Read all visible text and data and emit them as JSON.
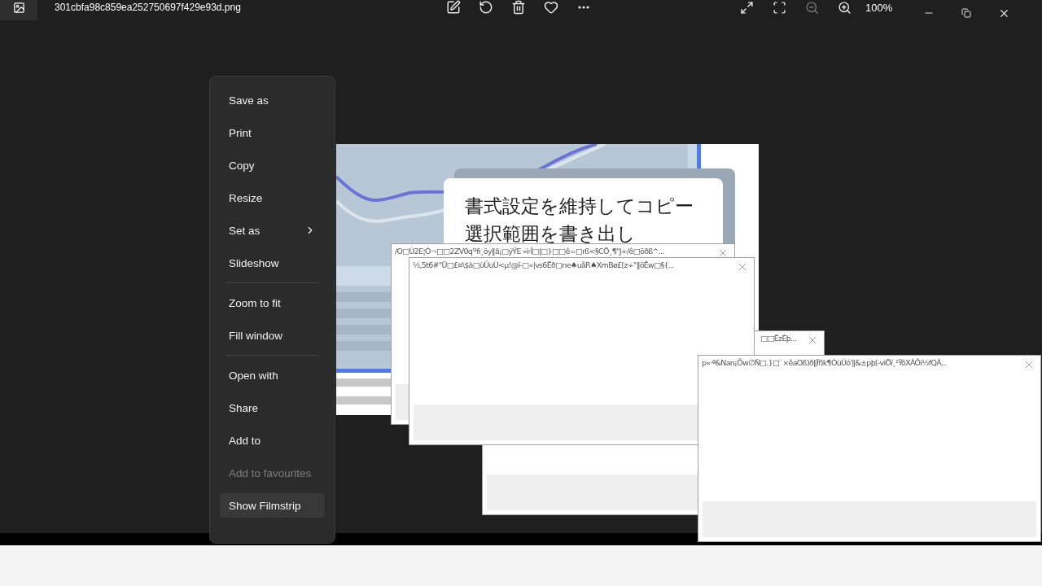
{
  "titlebar": {
    "file_name": "301cbfa98c859ea252750697f429e93d.png",
    "zoom": "100%"
  },
  "image": {
    "lines": [
      "書式設定を維持してコピー",
      "選択範囲を書き出し"
    ]
  },
  "dialogs": [
    {
      "title": "/O□Ù2E¦Ò¬□□2ZV0q'²fi¸õy‖ã¡□ýÝE »ì·Í□|□}□□ê=□rß<§CÖ¸¶\"J÷/ê□öðß^..."
    },
    {
      "title": "½,5t6#\"Ü□£¤\\$à□ùÛuÙ<µ!@î-□«|vs6Ëð□ne♠uåR♠XmBø£[z÷\"‖öÊw□§{..."
    },
    {
      "title": "□□ËzÈþ..."
    },
    {
      "title": "p«·ª&Nan¡Õw∅Ñ□.}□`×êaOß)ð‖Ïf)k¶ÒùÛó'‖&±pþ[-viÖï¸¹ŸõXÀÕi½fQÀ..."
    }
  ],
  "context_menu": {
    "groups": [
      [
        {
          "label": "Save as",
          "disabled": false,
          "highlighted": false,
          "submenu": false
        },
        {
          "label": "Print",
          "disabled": false,
          "highlighted": false,
          "submenu": false
        },
        {
          "label": "Copy",
          "disabled": false,
          "highlighted": false,
          "submenu": false
        },
        {
          "label": "Resize",
          "disabled": false,
          "highlighted": false,
          "submenu": false
        },
        {
          "label": "Set as",
          "disabled": false,
          "highlighted": false,
          "submenu": true
        },
        {
          "label": "Slideshow",
          "disabled": false,
          "highlighted": false,
          "submenu": false
        }
      ],
      [
        {
          "label": "Zoom to fit",
          "disabled": false,
          "highlighted": false,
          "submenu": false
        },
        {
          "label": "Fill window",
          "disabled": false,
          "highlighted": false,
          "submenu": false
        }
      ],
      [
        {
          "label": "Open with",
          "disabled": false,
          "highlighted": false,
          "submenu": false
        },
        {
          "label": "Share",
          "disabled": false,
          "highlighted": false,
          "submenu": false
        },
        {
          "label": "Add to",
          "disabled": false,
          "highlighted": false,
          "submenu": false
        },
        {
          "label": "Add to favourites",
          "disabled": true,
          "highlighted": false,
          "submenu": false
        },
        {
          "label": "Show Filmstrip",
          "disabled": false,
          "highlighted": true,
          "submenu": false
        }
      ]
    ]
  }
}
